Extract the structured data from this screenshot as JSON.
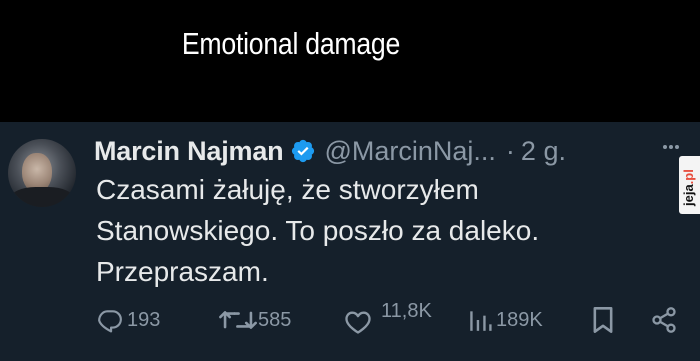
{
  "caption": {
    "text": "Emotional damage"
  },
  "tweet": {
    "author_name": "Marcin Najman",
    "handle": "@MarcinNaj...",
    "separator": "·",
    "time": "2 g.",
    "lines": [
      "Czasami żałuję, że stworzyłem",
      "Stanowskiego. To poszło za daleko.",
      "Przepraszam."
    ],
    "icons": {
      "avatar": "avatar",
      "verified": "verified-badge-icon",
      "more": "more-icon",
      "reply": "reply-icon",
      "retweet": "retweet-icon",
      "like": "heart-icon",
      "views": "views-chart-icon",
      "bookmark": "bookmark-icon",
      "share": "share-icon"
    }
  },
  "actions": {
    "replies": "193",
    "retweets": "585",
    "likes": "11,8K",
    "views": "189K"
  },
  "watermark": {
    "text_main": "jeja",
    "text_accent": ".pl"
  },
  "colors": {
    "tweet_background": "#15202b",
    "text_primary": "#e7e9ea",
    "text_secondary": "#8b98a5",
    "verified_blue": "#1d9bf0"
  }
}
